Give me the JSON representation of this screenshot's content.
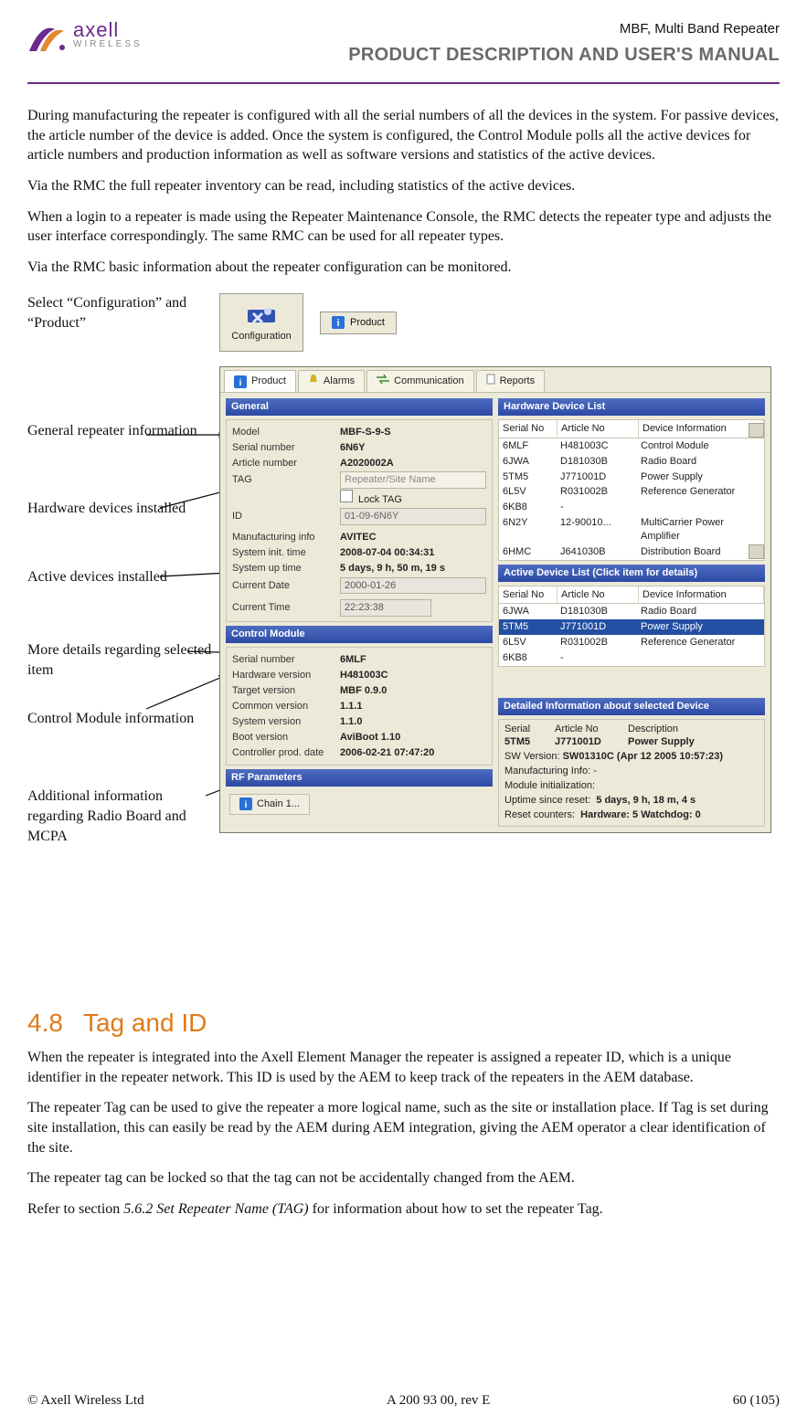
{
  "header": {
    "brand": "axell",
    "brand_sub": "WIRELESS",
    "doc_title": "MBF, Multi Band Repeater",
    "doc_subtitle": "PRODUCT DESCRIPTION AND USER'S MANUAL"
  },
  "paragraphs": {
    "p1": "During manufacturing the repeater is configured with all the serial numbers of all the devices in the system. For passive devices, the article number of the device is added. Once the system is configured, the Control Module polls all the active devices for article numbers and production information as well as software versions and statistics of the active devices.",
    "p2": "Via the RMC the full repeater inventory can be read, including statistics of the active devices.",
    "p3": "When a login to a repeater is made using the Repeater Maintenance Console, the RMC detects the repeater type and adjusts the user interface correspondingly. The same RMC can be used for all repeater types.",
    "p4": "Via the RMC basic information about the repeater configuration can be monitored."
  },
  "callouts": {
    "c1": "Select “Configuration” and  “Product”",
    "c2": "General repeater information",
    "c3": "Hardware devices installed",
    "c4": "Active devices installed",
    "c5": "More details regarding selected item",
    "c6": "Control Module information",
    "c7": "Additional information regarding Radio Board and MCPA"
  },
  "ui": {
    "config_btn": "Configuration",
    "product_btn": "Product",
    "tabs": {
      "product": "Product",
      "alarms": "Alarms",
      "comm": "Communication",
      "reports": "Reports"
    },
    "general": {
      "title": "General",
      "model_k": "Model",
      "model_v": "MBF-S-9-S",
      "serial_k": "Serial number",
      "serial_v": "6N6Y",
      "article_k": "Article number",
      "article_v": "A2020002A",
      "tag_k": "TAG",
      "tag_ph": "Repeater/Site Name",
      "locktag": "Lock TAG",
      "id_k": "ID",
      "id_v": "01-09-6N6Y",
      "mfg_k": "Manufacturing info",
      "mfg_v": "AVITEC",
      "init_k": "System init. time",
      "init_v": "2008-07-04    00:34:31",
      "uptime_k": "System up time",
      "uptime_v": "5 days, 9 h, 50 m, 19 s",
      "curdate_k": "Current Date",
      "curdate_v": "2000-01-26",
      "curtime_k": "Current Time",
      "curtime_v": "22:23:38"
    },
    "control": {
      "title": "Control Module",
      "serial_k": "Serial number",
      "serial_v": "6MLF",
      "hw_k": "Hardware version",
      "hw_v": "H481003C",
      "target_k": "Target version",
      "target_v": "MBF 0.9.0",
      "common_k": "Common version",
      "common_v": "1.1.1",
      "system_k": "System version",
      "system_v": "1.1.0",
      "boot_k": "Boot version",
      "boot_v": "AviBoot 1.10",
      "prod_k": "Controller prod. date",
      "prod_v": "2006-02-21    07:47:20"
    },
    "rf": {
      "title": "RF Parameters",
      "chain_btn": "Chain 1..."
    },
    "hw_list": {
      "title": "Hardware Device List",
      "h1": "Serial No",
      "h2": "Article No",
      "h3": "Device Information",
      "rows": [
        {
          "s": "6MLF",
          "a": "H481003C",
          "d": "Control Module"
        },
        {
          "s": "6JWA",
          "a": "D181030B",
          "d": "Radio Board"
        },
        {
          "s": "5TM5",
          "a": "J771001D",
          "d": "Power Supply"
        },
        {
          "s": "6L5V",
          "a": "R031002B",
          "d": "Reference Generator"
        },
        {
          "s": "6KB8",
          "a": "-",
          "d": ""
        },
        {
          "s": "6N2Y",
          "a": "12-90010...",
          "d": "MultiCarrier Power Amplifier"
        },
        {
          "s": "6HMC",
          "a": "J641030B",
          "d": "Distribution Board"
        }
      ]
    },
    "active_list": {
      "title": "Active Device List  (Click item for details)",
      "h1": "Serial No",
      "h2": "Article No",
      "h3": "Device Information",
      "rows": [
        {
          "s": "6JWA",
          "a": "D181030B",
          "d": "Radio Board"
        },
        {
          "s": "5TM5",
          "a": "J771001D",
          "d": "Power Supply",
          "sel": true
        },
        {
          "s": "6L5V",
          "a": "R031002B",
          "d": "Reference Generator"
        },
        {
          "s": "6KB8",
          "a": "-",
          "d": ""
        }
      ]
    },
    "details": {
      "title": "Detailed Information about selected Device",
      "h1": "Serial",
      "h2": "Article No",
      "h3": "Description",
      "serial": "5TM5",
      "article": "J771001D",
      "desc": "Power Supply",
      "sw_k": "SW Version:",
      "sw_v": "SW01310C (Apr 12 2005  10:57:23)",
      "mfg_k": "Manufacturing Info:",
      "mfg_v": "-",
      "modinit_k": "Module initialization:",
      "uptime_k": "Uptime since reset:",
      "uptime_v": "5 days, 9 h, 18 m, 4 s",
      "reset_k": "Reset counters:",
      "reset_v": "Hardware: 5  Watchdog: 0"
    }
  },
  "section48": {
    "num": "4.8",
    "title": "Tag and ID",
    "p1": "When the repeater is integrated into the Axell Element Manager the repeater is assigned a repeater ID, which is a unique identifier in the repeater network. This ID is used by the AEM to keep track of the repeaters in the AEM database.",
    "p2": "The repeater Tag can be used to give the repeater a more logical name, such as the site or installation place. If Tag is set during site installation, this can easily be read by the AEM during AEM integration, giving the AEM operator a clear identification of the site.",
    "p3": "The repeater tag can be locked so that the tag can not be accidentally changed from the AEM.",
    "p4_a": "Refer to section ",
    "p4_i": "5.6.2 Set Repeater Name (TAG)",
    "p4_b": " for information about how to set the repeater Tag."
  },
  "footer": {
    "left": "© Axell Wireless Ltd",
    "center": "A 200 93 00, rev E",
    "right": "60 (105)"
  }
}
